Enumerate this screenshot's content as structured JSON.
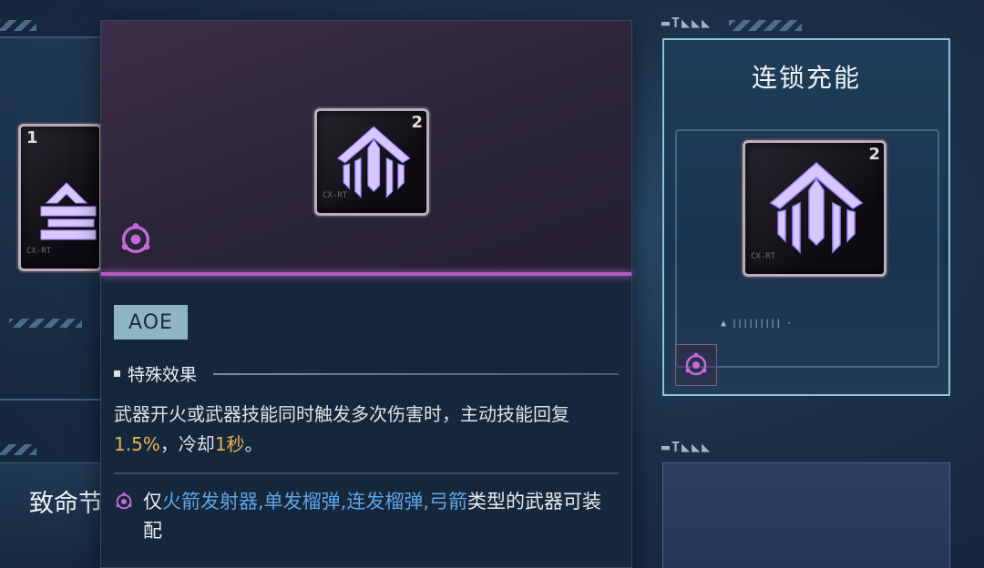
{
  "left_card": {
    "item_level": "1",
    "item_tag": "CX-RT",
    "bottom_title": "致命节"
  },
  "tooltip": {
    "item_level": "2",
    "item_tag": "CX-RT",
    "tag_badge": "AOE",
    "section_title": "特殊效果",
    "desc_part1": "武器开火或武器技能同时触发多次伤害时，主动技能回复",
    "desc_value1": "1.5%",
    "desc_part2": "，冷却",
    "desc_value2": "1秒",
    "desc_part3": "。",
    "equip_prefix": "仅",
    "equip_weapons": "火箭发射器,单发榴弹,连发榴弹,弓箭",
    "equip_suffix": "类型的武器可装配"
  },
  "right_card": {
    "title": "连锁充能",
    "item_level": "2",
    "item_tag": "CX-RT"
  },
  "colors": {
    "highlight": "#e4b454",
    "weapon_link": "#5da4e8",
    "rarity_bar": "#b25bc5",
    "selected_border": "#8cc4d4"
  },
  "icons": [
    "module-chip-icon",
    "hexagon-core-icon",
    "arrow-emblem-icon"
  ]
}
